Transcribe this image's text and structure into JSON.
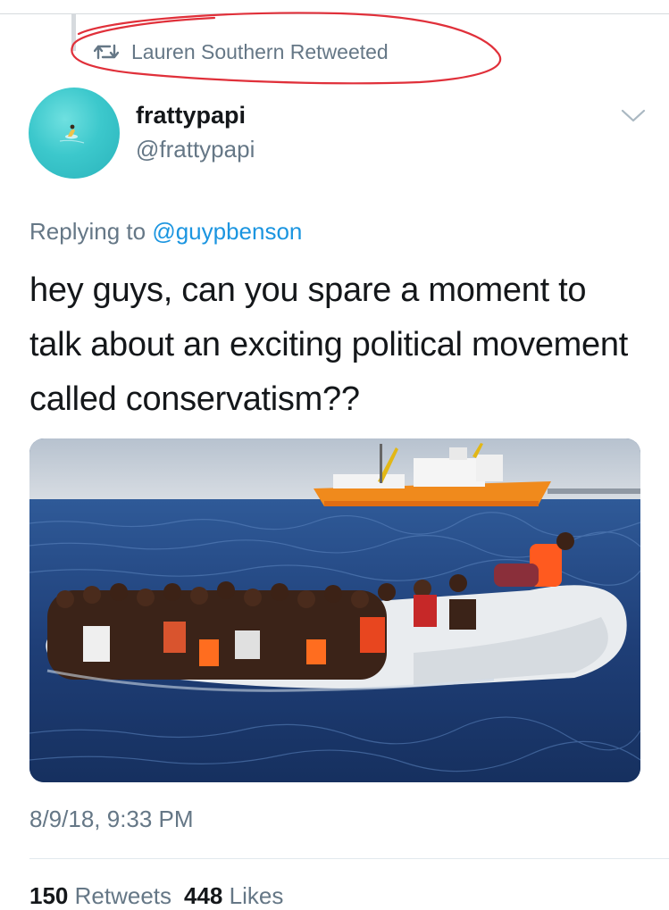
{
  "retweet_context": {
    "text": "Lauren Southern Retweeted",
    "icon": "retweet-icon",
    "annotation_color": "#e0303a"
  },
  "author": {
    "display_name": "frattypapi",
    "handle": "@frattypapi",
    "avatar_icon": "avatar-surfer"
  },
  "reply": {
    "prefix": "Replying to",
    "mention": "@guypbenson"
  },
  "tweet": {
    "text": "hey guys, can you spare a moment to talk about an exciting political movement called conservatism??",
    "media_icon": "photo-migrants-raft-at-sea"
  },
  "timestamp": "8/9/18, 9:33 PM",
  "stats": {
    "retweets_count": "150",
    "retweets_label": "Retweets",
    "likes_count": "448",
    "likes_label": "Likes"
  },
  "colors": {
    "link": "#1b95e0",
    "secondary_text": "#657786",
    "primary_text": "#14171a"
  }
}
